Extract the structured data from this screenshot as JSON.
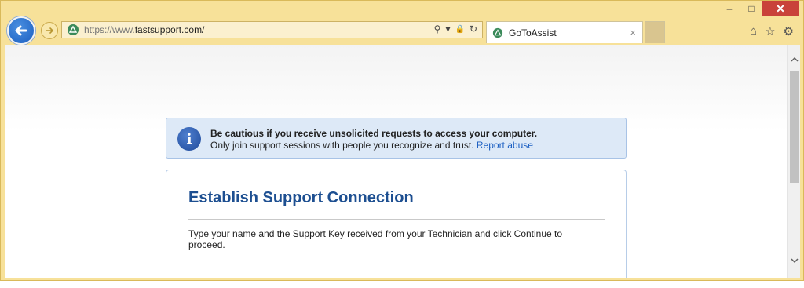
{
  "window": {
    "minimize": "–",
    "maximize": "□",
    "close": "✕"
  },
  "toolbar": {
    "url_host": "https://www.",
    "url_domain": "fastsupport.com/",
    "search_icon": "⚲",
    "dropdown_icon": "▾",
    "lock_icon": "🔒",
    "refresh_icon": "↻"
  },
  "tab": {
    "title": "GoToAssist",
    "close": "×"
  },
  "right_icons": {
    "home": "⌂",
    "favorites": "☆",
    "settings": "⚙"
  },
  "notice": {
    "headline": "Be cautious if you receive unsolicited requests to access your computer.",
    "body": "Only join support sessions with people you recognize and trust.",
    "link": "Report abuse"
  },
  "card": {
    "title": "Establish Support Connection",
    "instructions": "Type your name and the Support Key received from your Technician and click Continue to proceed."
  },
  "colors": {
    "frame": "#f7e199",
    "accent_blue": "#1d4f91",
    "link_blue": "#1c5fc2",
    "notice_bg": "#dde9f7",
    "close_red": "#c9423a"
  }
}
